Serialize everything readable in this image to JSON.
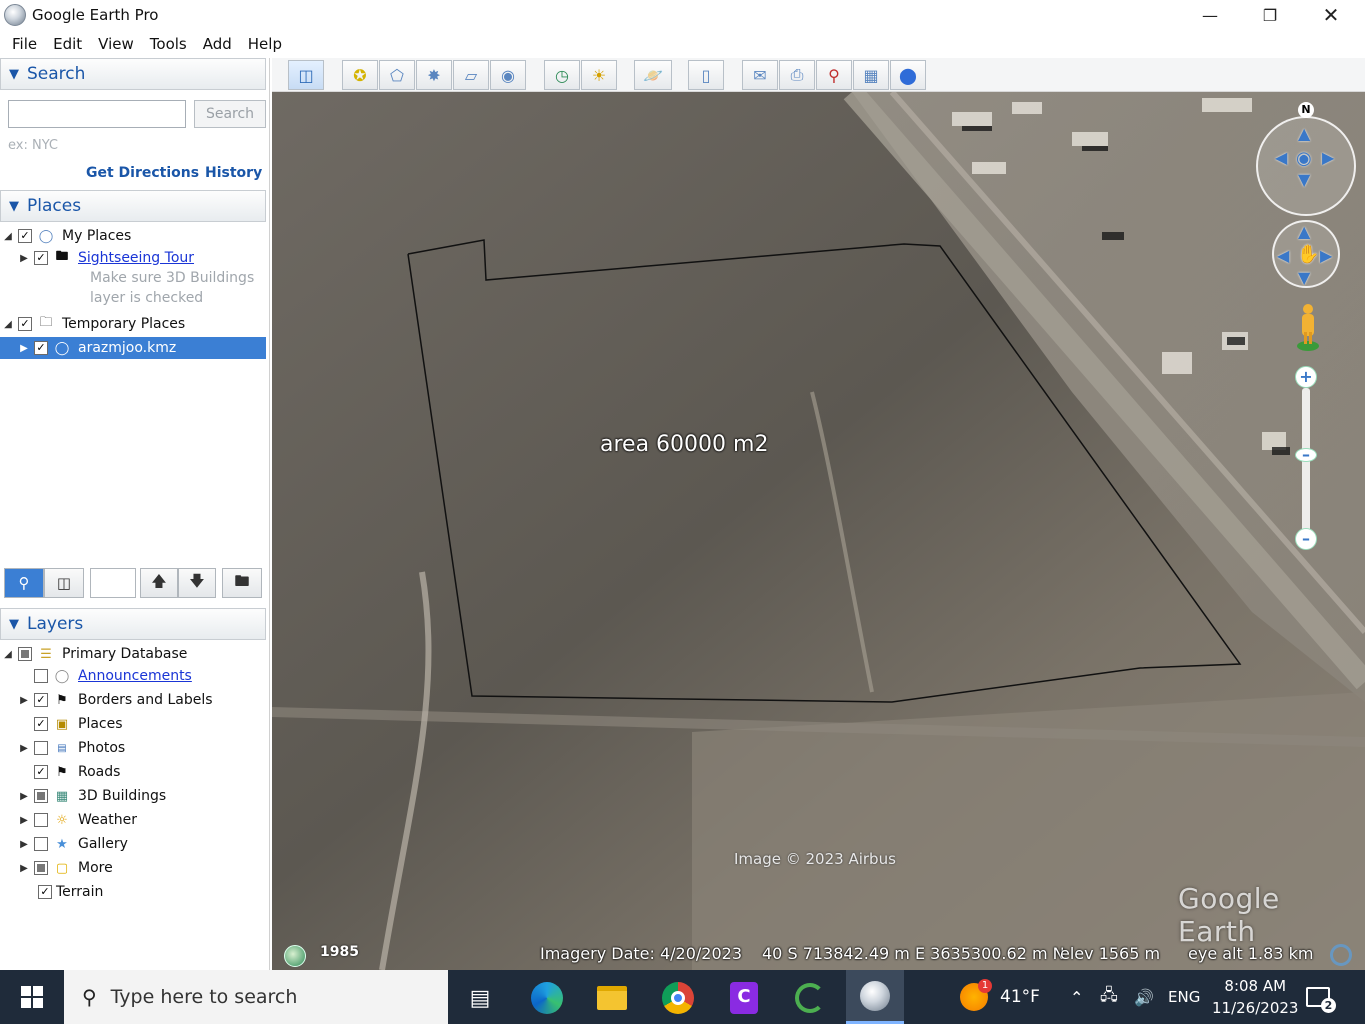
{
  "window": {
    "title": "Google Earth Pro"
  },
  "menu": [
    "File",
    "Edit",
    "View",
    "Tools",
    "Add",
    "Help"
  ],
  "search": {
    "header": "Search",
    "input_value": "",
    "button": "Search",
    "hint": "ex: NYC",
    "get_directions": "Get Directions",
    "history": "History"
  },
  "places": {
    "header": "Places",
    "items": [
      {
        "label": "My Places",
        "checked": true
      },
      {
        "label": "Sightseeing Tour",
        "checked": true,
        "link": true
      },
      {
        "label": "Make sure 3D Buildings",
        "dim": true
      },
      {
        "label": "layer is checked",
        "dim": true
      },
      {
        "label": "Temporary Places",
        "checked": true
      },
      {
        "label": "arazmjoo.kmz",
        "checked": true,
        "selected": true
      }
    ]
  },
  "layers": {
    "header": "Layers",
    "items": [
      {
        "label": "Primary Database",
        "state": "partial"
      },
      {
        "label": "Announcements",
        "state": "unchecked",
        "link": true
      },
      {
        "label": "Borders and Labels",
        "state": "checked"
      },
      {
        "label": "Places",
        "state": "checked"
      },
      {
        "label": "Photos",
        "state": "unchecked"
      },
      {
        "label": "Roads",
        "state": "checked"
      },
      {
        "label": "3D Buildings",
        "state": "partial"
      },
      {
        "label": "Weather",
        "state": "unchecked"
      },
      {
        "label": "Gallery",
        "state": "unchecked"
      },
      {
        "label": "More",
        "state": "partial"
      },
      {
        "label": "Terrain",
        "state": "checked"
      }
    ]
  },
  "map": {
    "area_label": "area   60000 m2",
    "image_copyright": "Image © 2023 Airbus",
    "logo": "Google Earth",
    "north": "N",
    "history_year": "1985",
    "imagery_date": "Imagery Date: 4/20/2023",
    "coords": "40 S 713842.49 m E 3635300.62 m N",
    "elev": "elev  1565 m",
    "eye_alt": "eye alt   1.83 km"
  },
  "taskbar": {
    "search_placeholder": "Type here to search",
    "weather": "41°F",
    "weather_badge": "1",
    "lang": "ENG",
    "time": "8:08 AM",
    "date": "11/26/2023",
    "notif_count": "2"
  }
}
